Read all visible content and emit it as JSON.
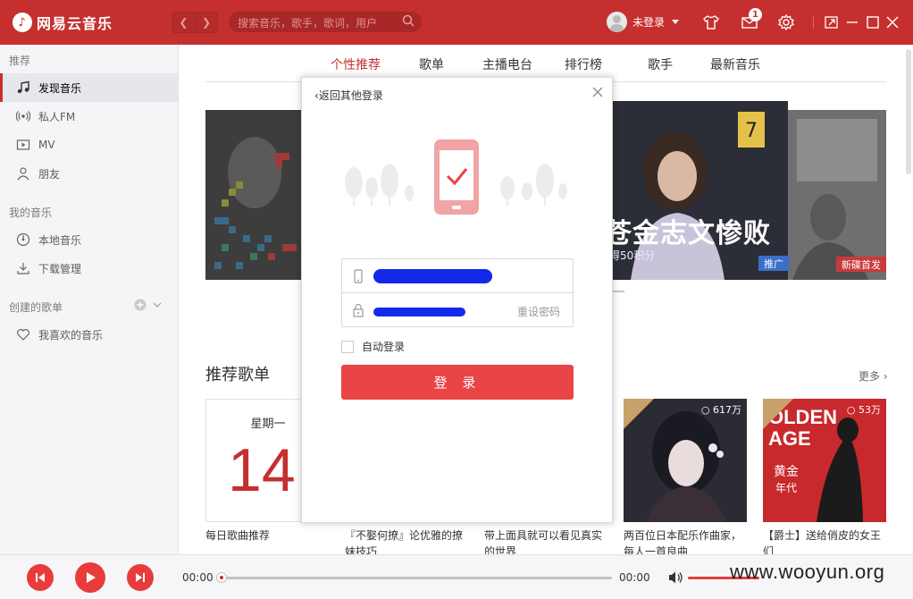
{
  "titlebar": {
    "app_name": "网易云音乐",
    "logo_icon": "netease-cloud-music-logo",
    "search_placeholder": "搜索音乐，歌手，歌词，用户",
    "user_label": "未登录",
    "mail_badge": "1"
  },
  "sidebar": {
    "section_recommend": "推荐",
    "items_recommend": [
      {
        "label": "发现音乐",
        "icon": "music-note-icon",
        "active": true
      },
      {
        "label": "私人FM",
        "icon": "radio-icon"
      },
      {
        "label": "MV",
        "icon": "video-icon"
      },
      {
        "label": "朋友",
        "icon": "friends-icon"
      }
    ],
    "section_my_music": "我的音乐",
    "items_my_music": [
      {
        "label": "本地音乐",
        "icon": "local-music-icon"
      },
      {
        "label": "下载管理",
        "icon": "download-icon"
      }
    ],
    "section_created": "创建的歌单",
    "items_created": [
      {
        "label": "我喜欢的音乐",
        "icon": "heart-icon"
      }
    ]
  },
  "main": {
    "tabs": [
      "个性推荐",
      "歌单",
      "主播电台",
      "排行榜",
      "歌手",
      "最新音乐"
    ],
    "active_tab": 0,
    "banner": {
      "headline": "苍金志文惨败",
      "sub": "得50积分",
      "tag_center": "推广",
      "tag_right": "新碟首发"
    },
    "recommend_title": "推荐歌单",
    "more": "更多",
    "cards": [
      {
        "weekday": "星期一",
        "day": "14",
        "caption": "每日歌曲推荐"
      },
      {
        "caption": "『不娶何撩』论优雅的撩妹技巧"
      },
      {
        "caption": "带上面具就可以看见真实的世界"
      },
      {
        "play_count": "617万",
        "caption": "两百位日本配乐作曲家，每人一首良曲"
      },
      {
        "play_count": "53万",
        "caption": "【爵士】送给俏皮的女王们"
      }
    ]
  },
  "dialog": {
    "back_label": "返回其他登录",
    "phone_value": "",
    "password_value": "",
    "reset_password": "重设密码",
    "auto_login": "自动登录",
    "login_button": "登 录"
  },
  "player": {
    "current_time": "00:00",
    "total_time": "00:00"
  },
  "watermark": "www.wooyun.org",
  "colors": {
    "brand_red": "#c62f2f",
    "button_red": "#e94446"
  }
}
